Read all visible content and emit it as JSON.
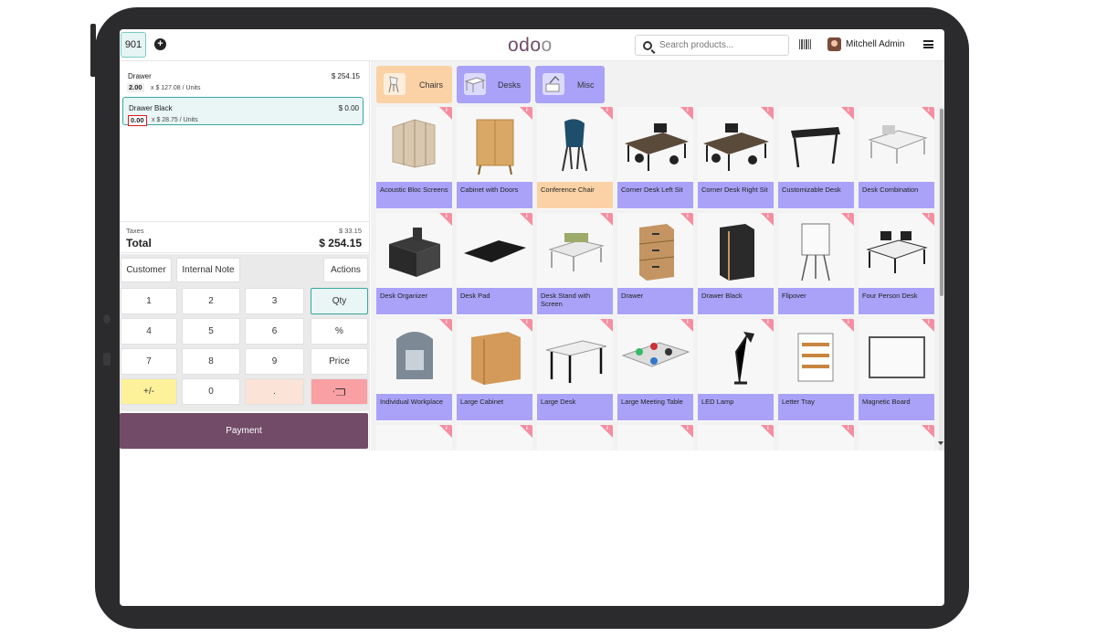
{
  "header": {
    "order_number": "901",
    "logo_main": "odo",
    "logo_tail": "o",
    "search_placeholder": "Search products...",
    "user_name": "Mitchell Admin"
  },
  "order_lines": [
    {
      "name": "Drawer",
      "price": "$ 254.15",
      "qty": "2.00",
      "unit_price": "x $ 127.08 / Units",
      "selected": false
    },
    {
      "name": "Drawer Black",
      "price": "$ 0.00",
      "qty": "0.00",
      "unit_price": "x $ 28.75 / Units",
      "selected": true
    }
  ],
  "totals": {
    "taxes_label": "Taxes",
    "taxes_value": "$ 33.15",
    "total_label": "Total",
    "total_value": "$ 254.15"
  },
  "actions": {
    "customer": "Customer",
    "internal_note": "Internal Note",
    "actions": "Actions"
  },
  "numpad": {
    "keys": [
      "1",
      "2",
      "3",
      "Qty",
      "4",
      "5",
      "6",
      "%",
      "7",
      "8",
      "9",
      "Price",
      "+/-",
      "0",
      ".",
      ""
    ]
  },
  "payment_label": "Payment",
  "categories": [
    {
      "label": "Chairs",
      "color": "#fbd2a6"
    },
    {
      "label": "Desks",
      "color": "#a9a2f8"
    },
    {
      "label": "Misc",
      "color": "#a9a2f8"
    }
  ],
  "products": [
    {
      "name": "Acoustic Bloc Screens",
      "color": "#a9a2f8"
    },
    {
      "name": "Cabinet with Doors",
      "color": "#a9a2f8"
    },
    {
      "name": "Conference Chair",
      "color": "#fbd2a6"
    },
    {
      "name": "Corner Desk Left Sit",
      "color": "#a9a2f8"
    },
    {
      "name": "Corner Desk Right Sit",
      "color": "#a9a2f8"
    },
    {
      "name": "Customizable Desk",
      "color": "#a9a2f8"
    },
    {
      "name": "Desk Combination",
      "color": "#a9a2f8"
    },
    {
      "name": "Desk Organizer",
      "color": "#a9a2f8"
    },
    {
      "name": "Desk Pad",
      "color": "#a9a2f8"
    },
    {
      "name": "Desk Stand with Screen",
      "color": "#a9a2f8"
    },
    {
      "name": "Drawer",
      "color": "#a9a2f8"
    },
    {
      "name": "Drawer Black",
      "color": "#a9a2f8"
    },
    {
      "name": "Flipover",
      "color": "#a9a2f8"
    },
    {
      "name": "Four Person Desk",
      "color": "#a9a2f8"
    },
    {
      "name": "Individual Workplace",
      "color": "#a9a2f8"
    },
    {
      "name": "Large Cabinet",
      "color": "#a9a2f8"
    },
    {
      "name": "Large Desk",
      "color": "#a9a2f8"
    },
    {
      "name": "Large Meeting Table",
      "color": "#a9a2f8"
    },
    {
      "name": "LED Lamp",
      "color": "#a9a2f8"
    },
    {
      "name": "Letter Tray",
      "color": "#a9a2f8"
    },
    {
      "name": "Magnetic Board",
      "color": "#a9a2f8"
    }
  ],
  "colors": {
    "brand": "#714b67",
    "accent": "#3aa6a1",
    "desk_category": "#a9a2f8",
    "chair_category": "#fbd2a6",
    "info_badge": "#f58ea0"
  }
}
